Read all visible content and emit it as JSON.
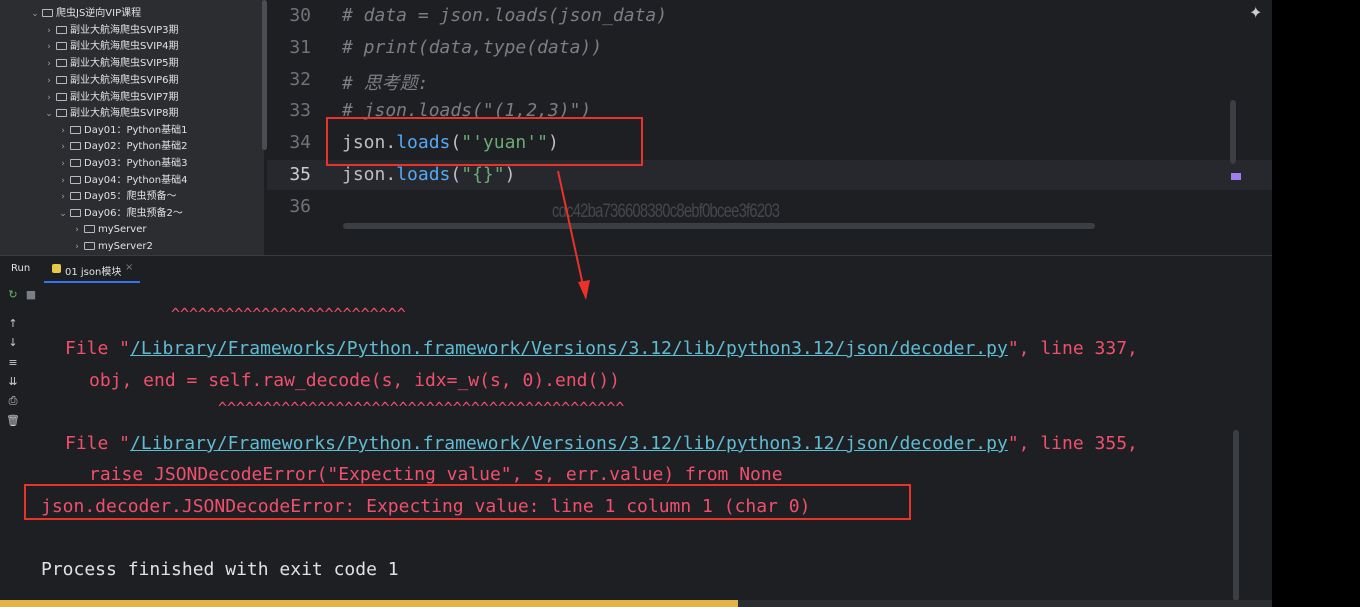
{
  "tree": {
    "items": [
      {
        "label": "爬虫JS逆向VIP课程",
        "chevron": "v"
      },
      {
        "label": "副业大航海爬虫SVIP3期",
        "chevron": ">"
      },
      {
        "label": "副业大航海爬虫SVIP4期",
        "chevron": ">"
      },
      {
        "label": "副业大航海爬虫SVIP5期",
        "chevron": ">"
      },
      {
        "label": "副业大航海爬虫SVIP6期",
        "chevron": ">"
      },
      {
        "label": "副业大航海爬虫SVIP7期",
        "chevron": ">"
      },
      {
        "label": "副业大航海爬虫SVIP8期",
        "chevron": "v"
      },
      {
        "label": "Day01：Python基础1",
        "chevron": ">"
      },
      {
        "label": "Day02：Python基础2",
        "chevron": ">"
      },
      {
        "label": "Day03：Python基础3",
        "chevron": ">"
      },
      {
        "label": "Day04：Python基础4",
        "chevron": ">"
      },
      {
        "label": "Day05：爬虫预备～",
        "chevron": ">"
      },
      {
        "label": "Day06：爬虫预备2～",
        "chevron": "v"
      },
      {
        "label": "myServer",
        "chevron": ">"
      },
      {
        "label": "myServer2",
        "chevron": ">"
      }
    ]
  },
  "editor": {
    "line_numbers": [
      "30",
      "31",
      "32",
      "33",
      "34",
      "35",
      "36"
    ],
    "line30": "# data = json.loads(json_data)",
    "line31": "# print(data,type(data))",
    "line32": "# 思考题:",
    "line33": "# json.loads(\"(1,2,3)\")",
    "line34": {
      "obj": "json",
      "dot": ".",
      "fn": "loads",
      "open": "(",
      "str": "\"'yuan'\"",
      "close": ")"
    },
    "line35": {
      "obj": "json",
      "dot": ".",
      "fn": "loads",
      "open": "(",
      "str": "\"{}\"",
      "close": ")"
    },
    "watermark": "cdc42ba736608380c8ebf0bcee3f6203",
    "ai_icon": "sparkle-icon"
  },
  "run": {
    "label": "Run",
    "tab_label": "01 json模块",
    "tab_close": "×"
  },
  "console": {
    "caret1": "^^^^^^^^^^^^^^^^^^^^^^^^^^",
    "file1_pre": "File \"",
    "file1_path": "/Library/Frameworks/Python.framework/Versions/3.12/lib/python3.12/json/decoder.py",
    "file1_post": "\", line 337,",
    "code1": "obj, end = self.raw_decode(s, idx=_w(s, 0).end())",
    "caret2": "^^^^^^^^^^^^^^^^^^^^^^^^^^^^^^^^^^^^^^^^^^^^^",
    "file2_pre": "File \"",
    "file2_path": "/Library/Frameworks/Python.framework/Versions/3.12/lib/python3.12/json/decoder.py",
    "file2_post": "\", line 355,",
    "code2": "raise JSONDecodeError(\"Expecting value\", s, err.value) from None",
    "error": "json.decoder.JSONDecodeError: Expecting value: line 1 column 1 (char 0)",
    "exit": "Process finished with exit code 1"
  },
  "colors": {
    "annotation": "#e8322a",
    "error_text": "#f0506e",
    "link": "#5fbcd3"
  },
  "progress": {
    "fraction": 0.58
  }
}
